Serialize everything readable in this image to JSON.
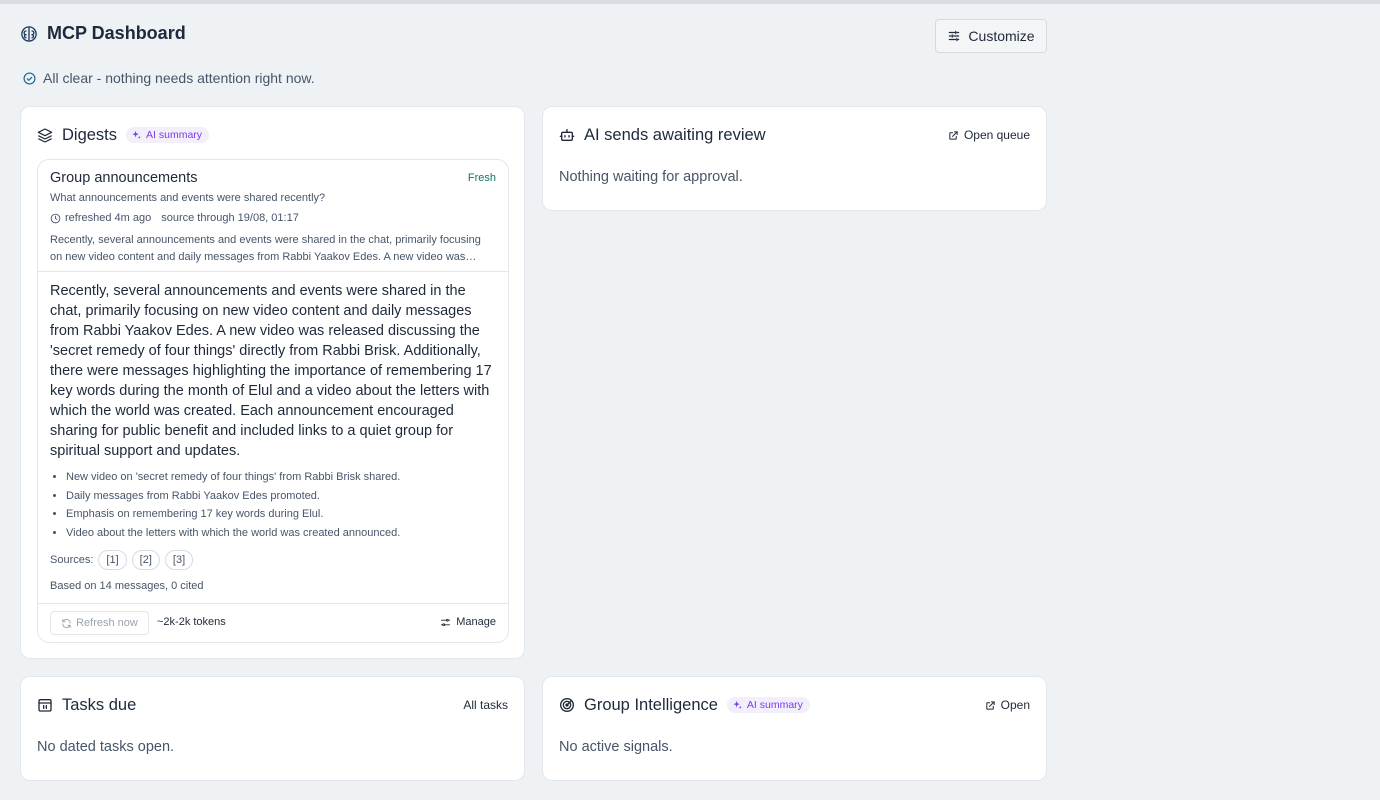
{
  "header": {
    "title": "MCP Dashboard",
    "customize_label": "Customize",
    "status": "All clear - nothing needs attention right now."
  },
  "digests": {
    "title": "Digests",
    "badge": "AI summary",
    "item": {
      "name": "Group announcements",
      "freshness": "Fresh",
      "question": "What announcements and events were shared recently?",
      "refreshed": "refreshed 4m ago",
      "source_through": "source through 19/08, 01:17",
      "preview": "Recently, several announcements and events were shared in the chat, primarily focusing on new video content and daily messages from Rabbi Yaakov Edes. A new video was released discussing the 'secret remedy of four things' directly from Rabbi Brisk.",
      "summary": "Recently, several announcements and events were shared in the chat, primarily focusing on new video content and daily messages from Rabbi Yaakov Edes. A new video was released discussing the 'secret remedy of four things' directly from Rabbi Brisk. Additionally, there were messages highlighting the importance of remembering 17 key words during the month of Elul and a video about the letters with which the world was created. Each announcement encouraged sharing for public benefit and included links to a quiet group for spiritual support and updates.",
      "bullets": [
        "New video on 'secret remedy of four things' from Rabbi Brisk shared.",
        "Daily messages from Rabbi Yaakov Edes promoted.",
        "Emphasis on remembering 17 key words during Elul.",
        "Video about the letters with which the world was created announced."
      ],
      "sources_label": "Sources:",
      "sources": [
        "[1]",
        "[2]",
        "[3]"
      ],
      "based_on": "Based on 14 messages, 0 cited",
      "refresh_label": "Refresh now",
      "tokens": "~2k-2k tokens",
      "manage_label": "Manage"
    }
  },
  "ai_sends": {
    "title": "AI sends awaiting review",
    "link": "Open queue",
    "empty": "Nothing waiting for approval."
  },
  "tasks": {
    "title": "Tasks due",
    "link": "All tasks",
    "empty": "No dated tasks open."
  },
  "group_intel": {
    "title": "Group Intelligence",
    "badge": "AI summary",
    "link": "Open",
    "empty": "No active signals."
  },
  "colors": {
    "background": "#eef2f5",
    "card": "#ffffff",
    "accent_purple": "#7c3aed",
    "fresh_teal": "#0f766e"
  }
}
